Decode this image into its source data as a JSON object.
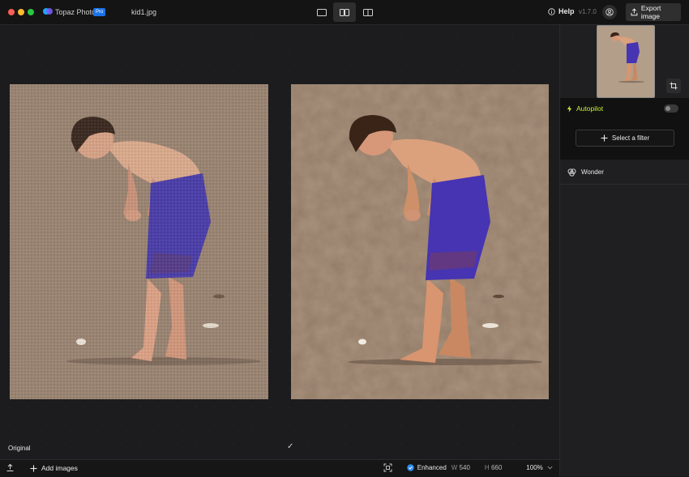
{
  "titlebar": {
    "app_name": "Topaz Photo",
    "badge": "Pro",
    "filename": "kid1.jpg",
    "help_label": "Help",
    "version": "v1.7.0",
    "export_label": "Export image"
  },
  "canvas": {
    "original_label": "Original",
    "compare_mark": "✓"
  },
  "bottombar": {
    "add_images_label": "Add images",
    "enhanced_label": "Enhanced",
    "width_label": "W",
    "width_value": "540",
    "height_label": "H",
    "height_value": "660",
    "zoom": "100%"
  },
  "sidebar": {
    "autopilot_label": "Autopilot",
    "select_filter_label": "Select a filter",
    "wonder_label": "Wonder"
  },
  "colors": {
    "accent_green": "#c6f133",
    "enhanced_blue": "#2d8cf0",
    "pro_badge": "#1a73e8"
  }
}
